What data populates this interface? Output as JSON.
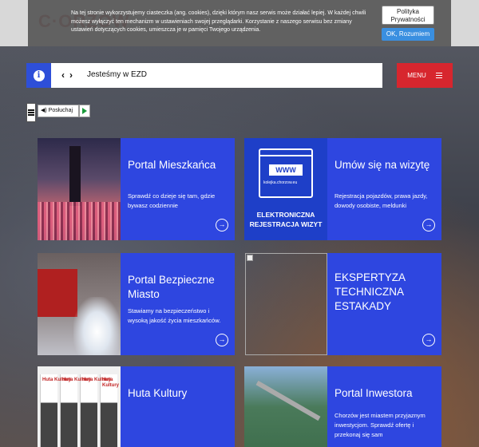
{
  "cookie": {
    "text": "Na tej stronie wykorzystujemy ciasteczka (ang. cookies), dzięki którym nasz serwis może działać lepiej. W każdej chwili możesz wyłączyć ten mechanizm w ustawieniach swojej przeglądarki. Korzystanie z naszego serwisu bez zmiany ustawień dotyczących cookies, umieszcza je w pamięci Twojego urządzenia.",
    "privacy_label": "Polityka Prywatności",
    "ok_label": "OK, Rozumiem"
  },
  "nav": {
    "info_icon": "info-icon",
    "ticker": "Jesteśmy w EZD",
    "prev": "‹",
    "next": "›",
    "menu_label": "MENU"
  },
  "toolbar": {
    "listen_label": "Posłuchaj"
  },
  "tiles": [
    {
      "title": "Portal Mieszkańca",
      "desc": "Sprawdź co dzieje się tam, gdzie bywasz codziennie"
    },
    {
      "title": "Umów się na wizytę",
      "desc": "Rejestracja pojazdów, prawa jazdy, dowody osobiste, meldunki",
      "image_label": "WWW",
      "image_url": "kolejka.chorzow.eu",
      "image_caption": "ELEKTRONICZNA REJESTRACJA WIZYT"
    },
    {
      "title": "Portal Bezpieczne Miasto",
      "desc": "Stawiamy na bezpieczeństwo i wysoką jakość życia mieszkańców."
    },
    {
      "title": "EKSPERTYZA TECHNICZNA ESTAKADY",
      "desc": ""
    },
    {
      "title": "Huta Kultury",
      "desc": "",
      "image_label": "Huta Kultury"
    },
    {
      "title": "Portal Inwestora",
      "desc": "Chorzów jest miastem przyjaznym inwestycjom. Sprawdź ofertę i przekonaj się sam"
    }
  ],
  "colors": {
    "tile_blue": "#2e46e0",
    "menu_red": "#d7262e",
    "info_blue": "#2e4fd8",
    "ok_blue": "#3a8fe0"
  }
}
